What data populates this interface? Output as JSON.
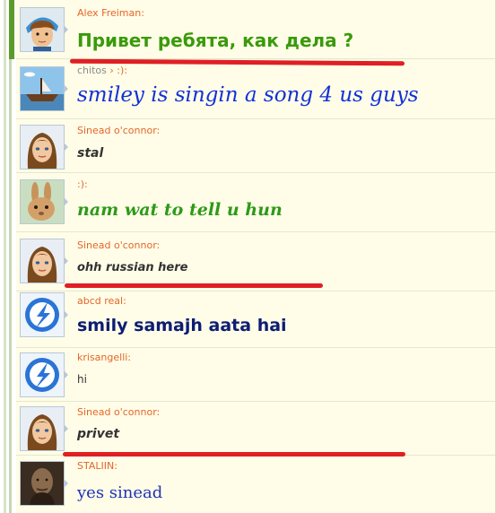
{
  "messages": [
    {
      "author": "Alex Freiman:",
      "author_extra": "",
      "text": "Привет ребята, как дела ?",
      "avatar": "cartoon-boy-cap-avatar"
    },
    {
      "author": "chitos",
      "author_extra": "› :):",
      "text": "smiley is singin a song 4 us guys",
      "avatar": "boat-avatar"
    },
    {
      "author": "Sinead o'connor:",
      "author_extra": "",
      "text": "stal",
      "avatar": "cartoon-girl-avatar"
    },
    {
      "author": ":):",
      "author_extra": "",
      "text": "nam wat to tell u hun",
      "avatar": "rabbit-avatar"
    },
    {
      "author": "Sinead o'connor:",
      "author_extra": "",
      "text": "ohh russian here",
      "avatar": "cartoon-girl-avatar"
    },
    {
      "author": "abcd real:",
      "author_extra": "",
      "text": "smily samajh aata hai",
      "avatar": "blue-bird-avatar"
    },
    {
      "author": "krisangelli:",
      "author_extra": "",
      "text": "hi",
      "avatar": "blue-bird-avatar"
    },
    {
      "author": "Sinead o'connor:",
      "author_extra": "",
      "text": "privet",
      "avatar": "cartoon-girl-avatar"
    },
    {
      "author": "STALIIN:",
      "author_extra": "",
      "text": "yes sinead",
      "avatar": "photo-avatar"
    }
  ],
  "colors": {
    "author": "#e4662a",
    "highlight_underline": "#e01f24",
    "message_bg": "#fffde7"
  }
}
